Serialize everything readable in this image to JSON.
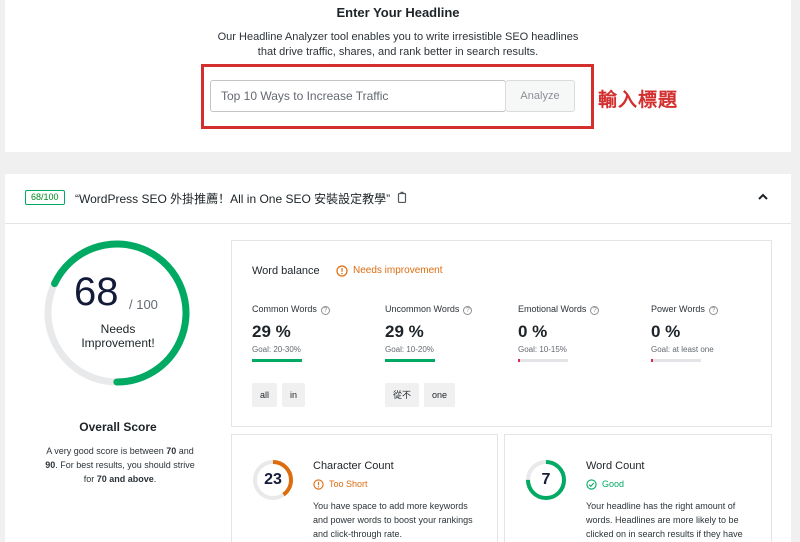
{
  "analyzer": {
    "title": "Enter Your Headline",
    "description_line1": "Our Headline Analyzer tool enables you to write irresistible SEO headlines",
    "description_line2": "that drive traffic, shares, and rank better in search results.",
    "input_placeholder": "Top 10 Ways to Increase Traffic",
    "analyze_label": "Analyze",
    "annotation": "輸入標題"
  },
  "result": {
    "score_badge": "68/100",
    "headline": "“WordPress SEO 外掛推薦！All in One SEO 安裝設定教學”",
    "overall": {
      "score": "68",
      "out_of": "/ 100",
      "label_line1": "Needs",
      "label_line2": "Improvement!",
      "score_fraction": 0.68,
      "title": "Overall Score",
      "desc_part1": "A very good score is between ",
      "desc_bold1": "70",
      "desc_part2": " and ",
      "desc_bold2": "90",
      "desc_part3": ". For best results, you should strive for ",
      "desc_bold3": "70 and above",
      "desc_part4": "."
    },
    "word_balance": {
      "title": "Word balance",
      "status": "Needs improvement",
      "metrics": [
        {
          "label": "Common Words",
          "value": "29 %",
          "goal": "Goal: 20-30%",
          "fill": 1.0,
          "color": "#00aa63"
        },
        {
          "label": "Uncommon Words",
          "value": "29 %",
          "goal": "Goal: 10-20%",
          "fill": 1.0,
          "color": "#00aa63"
        },
        {
          "label": "Emotional Words",
          "value": "0 %",
          "goal": "Goal: 10-15%",
          "fill": 0.04,
          "color": "#df2a4a"
        },
        {
          "label": "Power Words",
          "value": "0 %",
          "goal": "Goal: at least one",
          "fill": 0.04,
          "color": "#df2a4a"
        }
      ],
      "chips": [
        "all",
        "in",
        "從不",
        "one"
      ]
    },
    "character_count": {
      "value": "23",
      "title": "Character Count",
      "status": "Too Short",
      "fraction": 0.4,
      "desc": "You have space to add more keywords and power words to boost your rankings and click-through rate."
    },
    "word_count": {
      "value": "7",
      "title": "Word Count",
      "status": "Good",
      "fraction": 0.75,
      "desc": "Your headline has the right amount of words. Headlines are more likely to be clicked on in search results if they have"
    }
  },
  "colors": {
    "good": "#00aa63",
    "warning": "#dd6c0f",
    "bad": "#df2a4a",
    "annotation_red": "#d32f2f"
  },
  "icons": {
    "copy": "copy-icon",
    "collapse": "chevron-up-icon",
    "warning": "warning-circle-icon",
    "good": "check-circle-icon",
    "help": "help-circle-icon"
  }
}
